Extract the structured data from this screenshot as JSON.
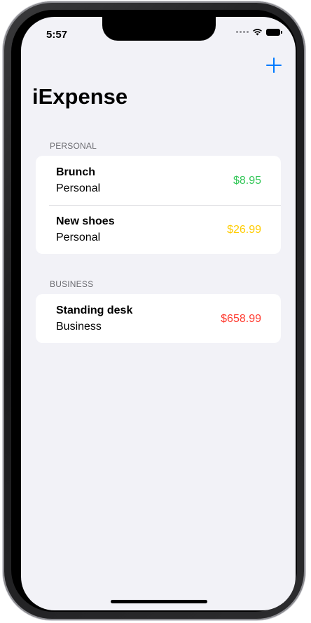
{
  "status_bar": {
    "time": "5:57"
  },
  "nav": {
    "title": "iExpense",
    "add_icon": "plus-icon"
  },
  "colors": {
    "accent": "#007aff",
    "amount_low": "#34c759",
    "amount_mid": "#ffcc00",
    "amount_high": "#ff3b30",
    "background": "#f2f2f7"
  },
  "sections": [
    {
      "header": "PERSONAL",
      "items": [
        {
          "name": "Brunch",
          "type": "Personal",
          "amount": "$8.95",
          "color": "#34c759"
        },
        {
          "name": "New shoes",
          "type": "Personal",
          "amount": "$26.99",
          "color": "#ffcc00"
        }
      ]
    },
    {
      "header": "BUSINESS",
      "items": [
        {
          "name": "Standing desk",
          "type": "Business",
          "amount": "$658.99",
          "color": "#ff3b30"
        }
      ]
    }
  ]
}
